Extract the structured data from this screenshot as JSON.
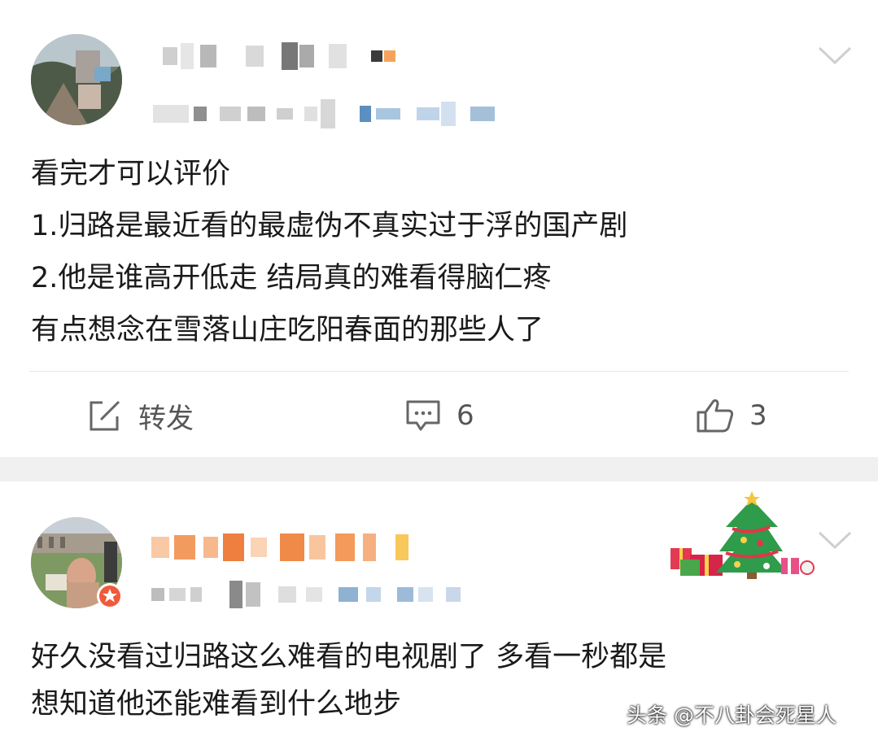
{
  "post1": {
    "content_lines": [
      "看完才可以评价",
      "1.归路是最近看的最虚伪不真实过于浮的国产剧",
      "2.他是谁高开低走 结局真的难看得脑仁疼",
      "有点想念在雪落山庄吃阳春面的那些人了"
    ],
    "actions": {
      "repost_label": "转发",
      "comment_count": "6",
      "like_count": "3"
    }
  },
  "post2": {
    "content_lines": [
      "好久没看过归路这么难看的电视剧了 多看一秒都是",
      "想知道他还能难看到什么地步"
    ]
  },
  "watermark": "头条 @不八卦会死星人",
  "icons": {
    "repost": "edit-square-icon",
    "comment": "comment-bubble-icon",
    "like": "thumbs-up-icon",
    "menu": "chevron-down-icon",
    "decoration": "christmas-tree-icon"
  },
  "colors": {
    "text": "#1a1a1a",
    "muted": "#555555",
    "separator": "#f0f0f0",
    "username_blur_orange": "#f5a35c"
  }
}
